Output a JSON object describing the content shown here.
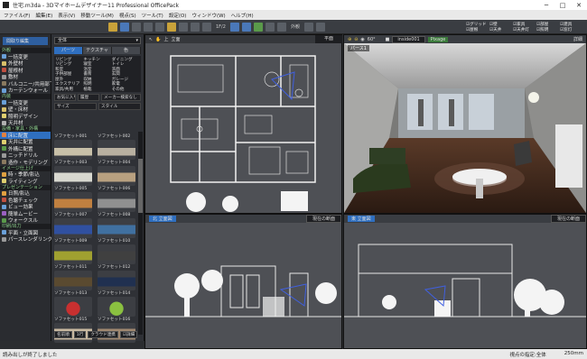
{
  "window": {
    "title": "住宅.m3da - 3Dマイホームデザイナー11 Professional OfficePack"
  },
  "menu": [
    "ファイル(F)",
    "編集(E)",
    "表示(V)",
    "移動ツール(M)",
    "視点(S)",
    "ツール(T)",
    "設定(O)",
    "ウィンドウ(W)",
    "ヘルプ(H)"
  ],
  "toolbar": {
    "floor": "1F/2",
    "exterior": "外観",
    "checks": [
      "グリッド",
      "壁",
      "家具",
      "部屋",
      "建具",
      "屋根",
      "天井",
      "天井灯",
      "照明",
      "窓灯"
    ]
  },
  "left_panel": {
    "title": "間取り編集",
    "sections": [
      {
        "header": "外観",
        "items": [
          "一括変更",
          "外壁材",
          "屋根材",
          "敷材",
          "バルコニー/共用部下",
          "カーテンウォール"
        ]
      },
      {
        "header": "内装",
        "items": [
          "一括変更",
          "壁・床材",
          "照明デザイン",
          "天井材"
        ]
      },
      {
        "header": "設備・家具・外構",
        "items": [
          "床に配置",
          "天井に配置",
          "外構に配置",
          "ニッチドリル",
          "造作・モデリング"
        ]
      },
      {
        "header": "イメージ仕上げ",
        "items": [
          "時・季節/影込",
          "ライティング"
        ]
      },
      {
        "header": "プレゼンテーション",
        "items": [
          "日照/影込",
          "色聴チェック",
          "ビュー効果",
          "簡単ムービー",
          "ウォークスル"
        ]
      },
      {
        "header": "印刷/出力",
        "items": [
          "平面・立面図",
          "パースレンダリング"
        ]
      }
    ],
    "selected": "床に配置"
  },
  "catalog": {
    "category": "全体",
    "tabs": [
      "パーツ",
      "テクスチャ",
      "色"
    ],
    "grid_items": [
      "リビング",
      "キッチン",
      "ダイニング",
      "リビング",
      "寝室",
      "トイレ",
      "和室",
      "浴室",
      "洗面",
      "子供部屋",
      "書斎",
      "玄関",
      "屋外",
      "収納",
      "ガレージ",
      "エクステリア",
      "照明",
      "家電",
      "家具/共用",
      "植栽",
      "その他"
    ],
    "filter_row1": [
      "お気に入り",
      "履歴",
      "メーカー検索なし"
    ],
    "filter_row2": [
      "サイズ",
      "スタイル"
    ],
    "thumbs": [
      "ソファセット001",
      "ソファセット002",
      "ソファセット003",
      "ソファセット004",
      "ソファセット005",
      "ソファセット006",
      "ソファセット007",
      "ソファセット008",
      "ソファセット009",
      "ソファセット010",
      "ソファセット011",
      "ソファセット012",
      "ソファセット013",
      "ソファセット014",
      "ソファセット015",
      "ソファセット016"
    ],
    "bottom": [
      "名前順",
      "1行",
      "クラウド連携",
      "詳細"
    ]
  },
  "plan": {
    "buttons": [
      "上",
      "立面"
    ],
    "badge": "平面"
  },
  "view3d": {
    "label": "パース1",
    "viewpoint": "inside001",
    "plugin": "Pixage",
    "angle": "60°",
    "tool": "詳細"
  },
  "elevation1": {
    "tab": "北 立面図",
    "dropdown": "現在の断面"
  },
  "elevation2": {
    "tab": "東 立面図",
    "dropdown": "現在の断面"
  },
  "status": {
    "left": "読み出しが終了しました",
    "mode": "視点の指定:全体",
    "scale": "250mm"
  },
  "colors": {
    "selected": "#2f6fc0",
    "section_text": "#8fd18f",
    "plan_bg": "#4e5055"
  }
}
